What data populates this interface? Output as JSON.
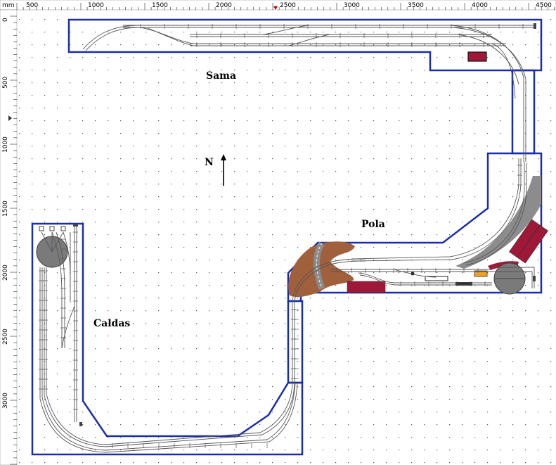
{
  "ruler": {
    "unit": "mm",
    "top_ticks": [
      "500",
      "1000",
      "1500",
      "2000",
      "2500",
      "3000",
      "3500",
      "4000",
      "4500"
    ],
    "left_ticks": [
      "0",
      "500",
      "1000",
      "1500",
      "2000",
      "2500",
      "3000"
    ]
  },
  "labels": {
    "sama": "Sama",
    "pola": "Pola",
    "caldas": "Caldas",
    "north": "N"
  },
  "colors": {
    "baseboard_outline": "#1a2daa",
    "track": "#555555",
    "building": "#a01838",
    "terrain": "#a0603c",
    "road": "#8c8c8c",
    "turntable": "#7a7a7a",
    "accent_yellow": "#f0a020"
  }
}
